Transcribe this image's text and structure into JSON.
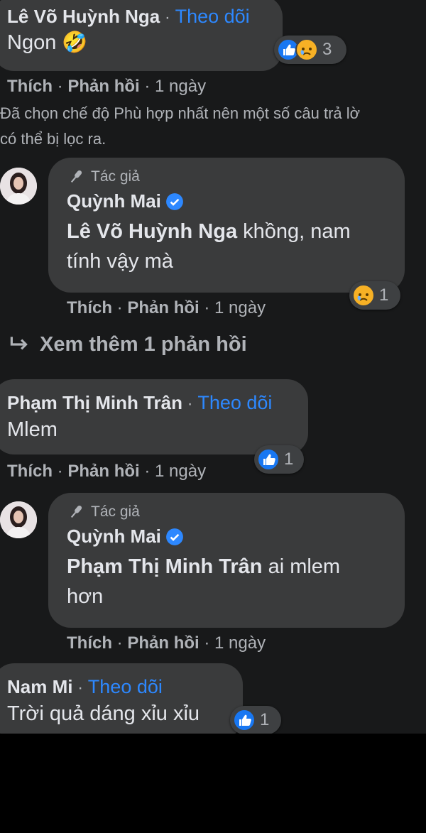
{
  "comments": [
    {
      "name": "Lê Võ Huỳnh Nga",
      "follow": "Theo dõi",
      "text": "Ngon 🤣",
      "reactions": {
        "icons": [
          "like-icon",
          "sad-icon"
        ],
        "count": "3"
      },
      "actions": {
        "like": "Thích",
        "reply": "Phản hồi",
        "time": "1 ngày"
      }
    },
    {
      "name": "Phạm Thị Minh Trân",
      "follow": "Theo dõi",
      "text": "Mlem",
      "reactions": {
        "icons": [
          "like-icon"
        ],
        "count": "1"
      },
      "actions": {
        "like": "Thích",
        "reply": "Phản hồi",
        "time": "1 ngày"
      }
    },
    {
      "name": "Nam Mi",
      "follow": "Theo dõi",
      "text": "Trời quả dáng xỉu xỉu",
      "reactions": {
        "icons": [
          "like-icon"
        ],
        "count": "1"
      }
    }
  ],
  "notice": {
    "line1": "Đã chọn chế độ Phù hợp nhất nên một số câu trả lờ",
    "line2": "có thể bị lọc ra."
  },
  "replies": [
    {
      "author_tag": "Tác giả",
      "name": "Quỳnh Mai",
      "mention": "Lê Võ Huỳnh Nga",
      "text_line1": " khồng, nam",
      "text_line2": "tính vậy mà",
      "reactions": {
        "icons": [
          "sad-icon"
        ],
        "count": "1"
      },
      "actions": {
        "like": "Thích",
        "reply": "Phản hồi",
        "time": "1 ngày"
      }
    },
    {
      "author_tag": "Tác giả",
      "name": "Quỳnh Mai",
      "mention": "Phạm Thị Minh Trân",
      "text_line1": " ai mlem",
      "text_line2": "hơn",
      "actions": {
        "like": "Thích",
        "reply": "Phản hồi",
        "time": "1 ngày"
      }
    }
  ],
  "view_more": "Xem thêm 1 phản hồi",
  "colors": {
    "background": "#18191a",
    "bubble": "#3a3b3c",
    "link": "#2d88ff",
    "secondary_text": "#b0b3b8",
    "like": "#1877f2",
    "sad": "#f7b125"
  }
}
